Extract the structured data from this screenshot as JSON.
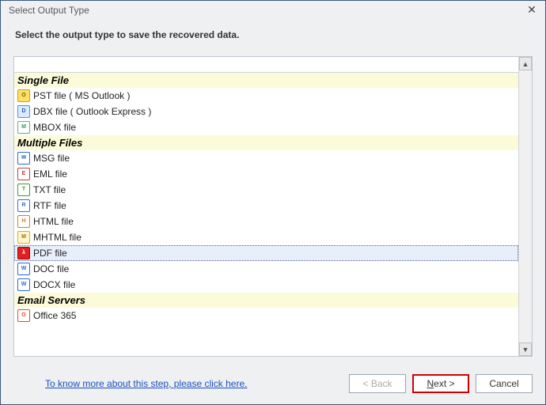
{
  "window": {
    "title": "Select Output Type",
    "close_symbol": "✕"
  },
  "instruction": "Select the output type to save the recovered data.",
  "groups": {
    "single": "Single File",
    "multiple": "Multiple Files",
    "servers": "Email Servers"
  },
  "items": {
    "pst": "PST file ( MS Outlook )",
    "dbx": "DBX file ( Outlook Express )",
    "mbox": "MBOX file",
    "msg": "MSG file",
    "eml": "EML file",
    "txt": "TXT file",
    "rtf": "RTF file",
    "html": "HTML file",
    "mhtml": "MHTML file",
    "pdf": "PDF file",
    "doc": "DOC file",
    "docx": "DOCX file",
    "o365": "Office 365"
  },
  "selected": "pdf",
  "footer": {
    "link": "To know more about this step, please click here.",
    "back": "< Back",
    "next": "Next >",
    "cancel": "Cancel"
  }
}
